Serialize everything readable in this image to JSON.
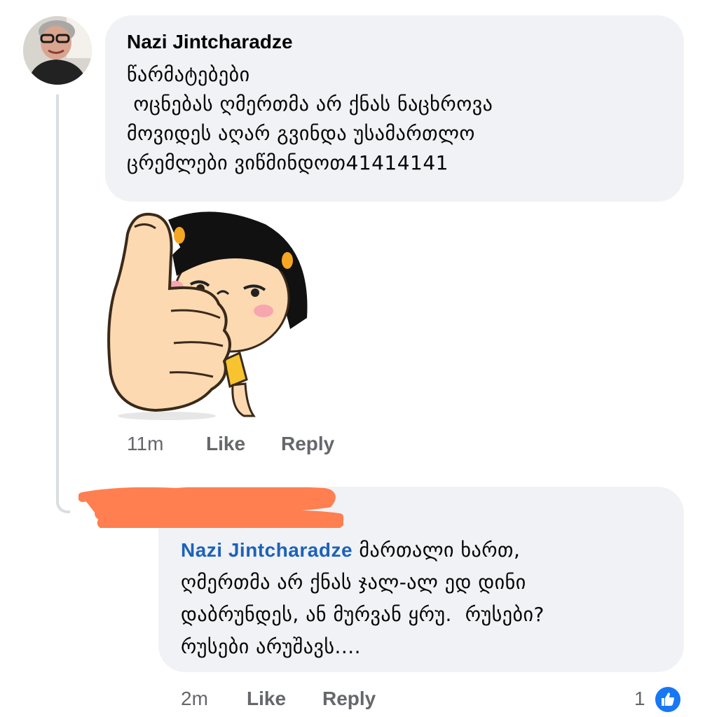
{
  "comment": {
    "author": "Nazi Jintcharadze",
    "text": "წარმატებები\n ოცნებას ღმერთმა არ ქნას ნაცხროვა\nმოვიდეს აღარ გვინდა უსამართლო\nცრემლები ვიწმინდოთ41414141",
    "time": "11m",
    "like_label": "Like",
    "reply_label": "Reply"
  },
  "reply": {
    "mention": "Nazi Jintcharadze",
    "text_first": " მართალი ხართ,",
    "text_rest": "ღმერთმა არ ქნას ჯალ-ალ ედ დინი\nდაბრუნდეს, ან მურვან ყრუ.  რუსები?\nრუსები არუშავს....",
    "time": "2m",
    "like_label": "Like",
    "reply_label": "Reply",
    "reaction_count": "1",
    "reaction_icon": "thumbs-up-icon"
  },
  "colors": {
    "bubble": "#f0f2f5",
    "mention": "#1d62b8",
    "meta": "#65676b",
    "redaction": "#ff7f50",
    "like_badge": "#1877f2"
  }
}
